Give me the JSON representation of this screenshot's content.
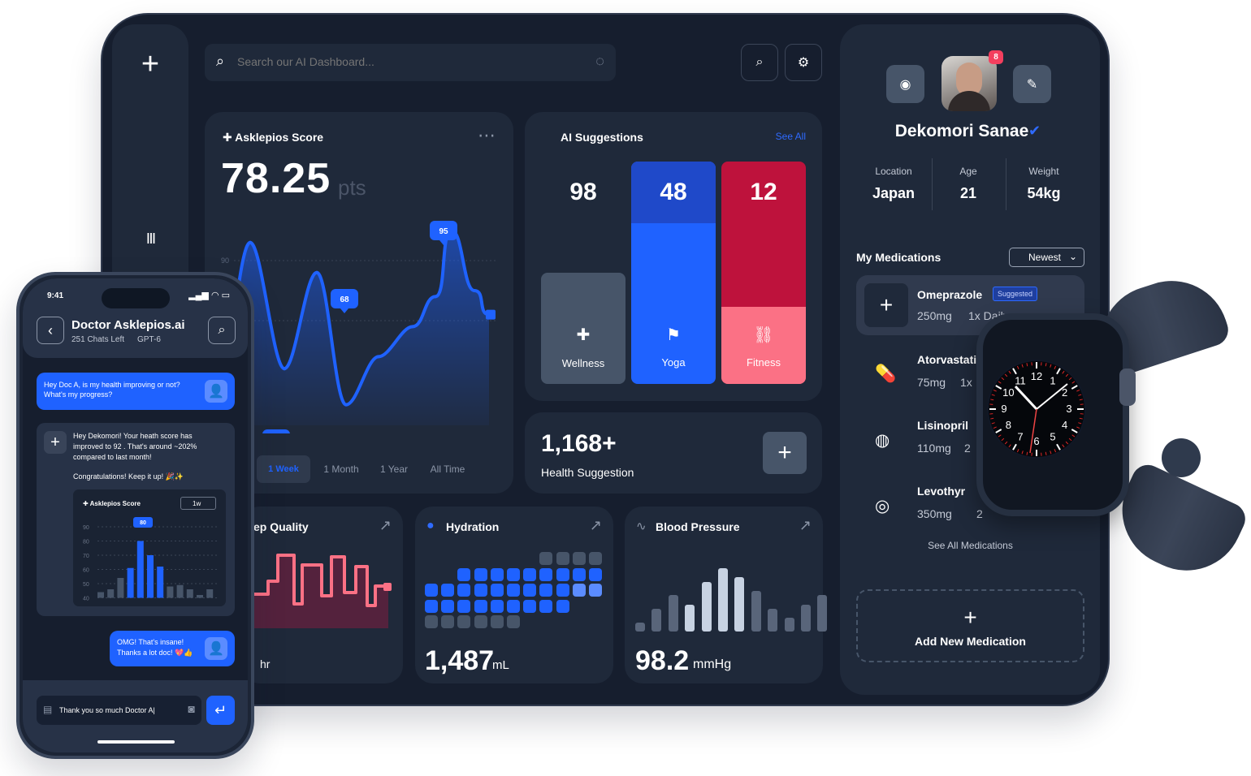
{
  "search": {
    "placeholder": "Search our AI Dashboard..."
  },
  "score": {
    "title": "Asklepios Score",
    "value": "78.25",
    "unit": "pts",
    "yticks": [
      "90",
      "80"
    ],
    "callouts": [
      "95",
      "68",
      "95"
    ],
    "ranges": [
      "1 Day",
      "1 Week",
      "1 Month",
      "1 Year",
      "All Time"
    ],
    "visible_day": "y",
    "active_range": "1 Week"
  },
  "ai": {
    "title": "AI Suggestions",
    "see_all": "See All",
    "items": [
      {
        "value": "98",
        "label": "Wellness"
      },
      {
        "value": "48",
        "label": "Yoga"
      },
      {
        "value": "12",
        "label": "Fitness"
      }
    ]
  },
  "health": {
    "value": "1,168+",
    "label": "Health Suggestion"
  },
  "sleep": {
    "title": "ep Quality",
    "value_unit": "hr"
  },
  "hydration": {
    "title": "Hydration",
    "value": "1,487",
    "unit": "mL"
  },
  "bp": {
    "title": "Blood Pressure",
    "value": "98.2",
    "unit": "mmHg"
  },
  "profile": {
    "name": "Dekomori Sanae",
    "badge": "8",
    "location_label": "Location",
    "location": "Japan",
    "age_label": "Age",
    "age": "21",
    "weight_label": "Weight",
    "weight": "54kg"
  },
  "meds": {
    "title": "My Medications",
    "sort": "Newest",
    "see_all": "See All Medications",
    "add": "Add New Medication",
    "items": [
      {
        "name": "Omeprazole",
        "tag": "Suggested",
        "dose": "250mg",
        "freq": "1x Daily"
      },
      {
        "name": "Atorvastati",
        "dose": "75mg",
        "freq": "1x"
      },
      {
        "name": "Lisinopril",
        "dose": "110mg",
        "freq": "2"
      },
      {
        "name": "Levothyr",
        "dose": "350mg",
        "freq": "2"
      }
    ]
  },
  "phone": {
    "time": "9:41",
    "title": "Doctor Asklepios.ai",
    "subtitle": "251 Chats Left",
    "model": "GPT-6",
    "msg1": "Hey Doc A, is my health improving or not? What's my progress?",
    "reply1": "Hey Dekomori! Your heath score has improved to 92 . That's around ~202% compared to last month!",
    "reply2": "Congratulations! Keep it up! 🎉✨",
    "mini_title": "Asklepios Score",
    "mini_range": "1w",
    "mini_callout": "80",
    "mini_yticks": [
      "90",
      "80",
      "70",
      "60",
      "50",
      "40"
    ],
    "msg2": "OMG! That's insane! Thanks a lot doc! 💖👍",
    "input": "Thank you so much Doctor A|"
  },
  "watch": {
    "numbers": [
      "12",
      "1",
      "2",
      "3",
      "4",
      "5",
      "6",
      "7",
      "8",
      "9",
      "10",
      "11"
    ]
  },
  "colors": {
    "bg": "#161e2e",
    "card": "#1f293a",
    "blue": "#1f62ff",
    "red": "#be123c",
    "pink": "#fb7185",
    "gray": "#475569"
  },
  "chart_data": [
    {
      "type": "line",
      "title": "Asklepios Score",
      "ylim": [
        70,
        95
      ],
      "yticks": [
        90,
        80
      ],
      "values": [
        70,
        93,
        72,
        88,
        66,
        74,
        79,
        84,
        95,
        85,
        81
      ],
      "highlights": [
        95,
        68,
        95
      ],
      "active_range": "1 Week"
    },
    {
      "type": "bar",
      "title": "AI Suggestions",
      "categories": [
        "Wellness",
        "Yoga",
        "Fitness"
      ],
      "values": [
        98,
        48,
        12
      ]
    },
    {
      "type": "bar",
      "title": "Blood Pressure",
      "values": [
        2,
        5,
        8,
        6,
        11,
        14,
        12,
        9,
        5,
        3,
        6,
        8
      ],
      "unit": "mmHg",
      "summary": 98.2
    },
    {
      "type": "bar",
      "title": "Asklepios Score",
      "values": [
        44,
        46,
        54,
        61,
        80,
        70,
        62,
        48,
        49,
        46,
        42,
        46
      ],
      "highlight": 80,
      "ylim": [
        40,
        90
      ]
    }
  ]
}
